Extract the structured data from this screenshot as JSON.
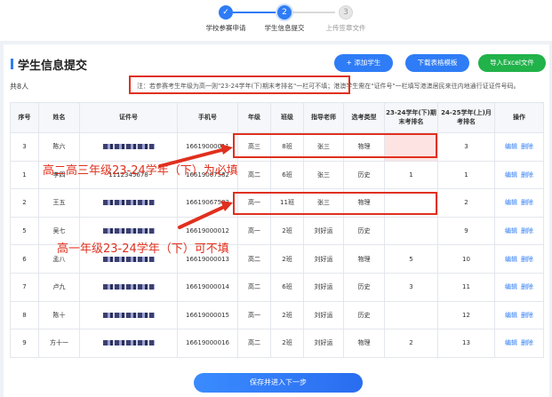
{
  "stepper": {
    "steps": [
      {
        "label": "学校参赛申请",
        "num": "✓"
      },
      {
        "label": "学生信息提交",
        "num": "2"
      },
      {
        "label": "上传签章文件",
        "num": "3"
      }
    ]
  },
  "header": {
    "title": "学生信息提交",
    "add_label": "+ 添加学生",
    "download_label": "下载表格模板",
    "import_label": "导入Excel文件"
  },
  "count_label": "共8人",
  "notice": "注：若参赛考生年级为高一则\"23-24学年(下)期末考排名\"一栏可不填；港澳学生需在\"证件号\"一栏填写港澳居民来往内地通行证证件号码。",
  "table": {
    "headers": [
      "序号",
      "姓名",
      "证件号",
      "手机号",
      "年级",
      "班级",
      "指导老师",
      "选考类型",
      "23-24学年(下)期末考排名",
      "24-25学年(上)月考排名",
      "操作"
    ],
    "rows": [
      {
        "no": "3",
        "name": "陈六",
        "id": "",
        "phone": "16619000011",
        "grade": "高三",
        "cls": "8班",
        "teacher": "张三",
        "type": "物理",
        "r1": "",
        "r2": "3"
      },
      {
        "no": "1",
        "name": "李四",
        "id": "1112345678",
        "phone": "16619067582",
        "grade": "高二",
        "cls": "6班",
        "teacher": "张三",
        "type": "历史",
        "r1": "1",
        "r2": "1"
      },
      {
        "no": "2",
        "name": "王五",
        "id": "",
        "phone": "16619067583",
        "grade": "高一",
        "cls": "11班",
        "teacher": "张三",
        "type": "物理",
        "r1": "",
        "r2": "2"
      },
      {
        "no": "5",
        "name": "吴七",
        "id": "",
        "phone": "16619000012",
        "grade": "高一",
        "cls": "2班",
        "teacher": "刘好运",
        "type": "历史",
        "r1": "",
        "r2": "9"
      },
      {
        "no": "6",
        "name": "孟八",
        "id": "",
        "phone": "16619000013",
        "grade": "高二",
        "cls": "2班",
        "teacher": "刘好运",
        "type": "物理",
        "r1": "5",
        "r2": "10"
      },
      {
        "no": "7",
        "name": "卢九",
        "id": "",
        "phone": "16619000014",
        "grade": "高二",
        "cls": "6班",
        "teacher": "刘好运",
        "type": "历史",
        "r1": "3",
        "r2": "11"
      },
      {
        "no": "8",
        "name": "陈十",
        "id": "",
        "phone": "16619000015",
        "grade": "高一",
        "cls": "2班",
        "teacher": "刘好运",
        "type": "历史",
        "r1": "",
        "r2": "12"
      },
      {
        "no": "9",
        "name": "方十一",
        "id": "",
        "phone": "16619000016",
        "grade": "高二",
        "cls": "2班",
        "teacher": "刘好运",
        "type": "物理",
        "r1": "2",
        "r2": "13"
      }
    ],
    "edit_label": "编辑",
    "delete_label": "删除"
  },
  "annotations": {
    "required": "高二高三年级23-24学年（下）为必填",
    "optional": "高一年级23-24学年（下）可不填"
  },
  "footer": {
    "save_label": "保存并进入下一步"
  },
  "colors": {
    "primary": "#2e7cf6",
    "success": "#21b24a",
    "annotation": "#e0301e",
    "highlight": "#fde4e2"
  }
}
